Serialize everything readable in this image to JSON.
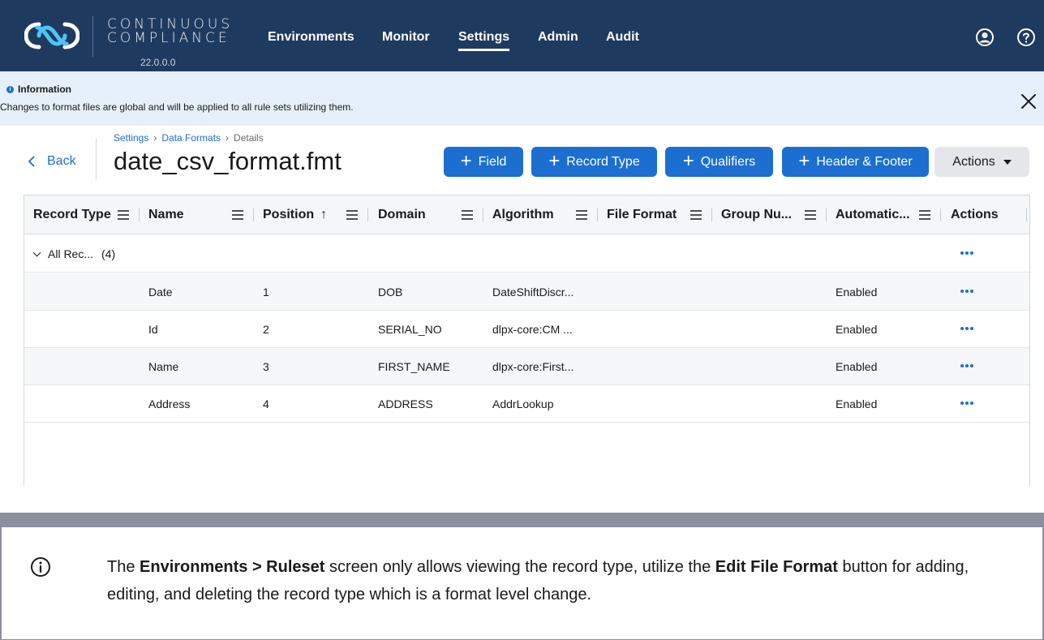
{
  "app": {
    "brand_line1": "CONTINUOUS",
    "brand_line2": "COMPLIANCE",
    "version": "22.0.0.0"
  },
  "nav": {
    "items": [
      {
        "label": "Environments"
      },
      {
        "label": "Monitor"
      },
      {
        "label": "Settings",
        "active": true
      },
      {
        "label": "Admin"
      },
      {
        "label": "Audit"
      }
    ],
    "icons": [
      "user-account-icon",
      "help-icon"
    ]
  },
  "banner": {
    "title": "Information",
    "text": "Changes to format files are global and will be applied to all rule sets utilizing them."
  },
  "page": {
    "back_label": "Back",
    "breadcrumb": [
      "Settings",
      "Data Formats",
      "Details"
    ],
    "title": "date_csv_format.fmt"
  },
  "toolbar": {
    "buttons": [
      "Field",
      "Record Type",
      "Qualifiers",
      "Header & Footer"
    ],
    "actions_label": "Actions"
  },
  "grid": {
    "columns": [
      "Record Type",
      "Name",
      "Position",
      "Domain",
      "Algorithm",
      "File Format",
      "Group Nu...",
      "Automatic...",
      "Actions"
    ],
    "sort_indicator": "↑",
    "group": {
      "label": "All Rec...",
      "count": "(4)"
    },
    "rows": [
      {
        "name": "Date",
        "position": "1",
        "domain": "DOB",
        "algorithm": "DateShiftDiscr...",
        "file_format": "",
        "group": "",
        "automatic": "Enabled"
      },
      {
        "name": "Id",
        "position": "2",
        "domain": "SERIAL_NO",
        "algorithm": "dlpx-core:CM ...",
        "file_format": "",
        "group": "",
        "automatic": "Enabled"
      },
      {
        "name": "Name",
        "position": "3",
        "domain": "FIRST_NAME",
        "algorithm": "dlpx-core:First...",
        "file_format": "",
        "group": "",
        "automatic": "Enabled"
      },
      {
        "name": "Address",
        "position": "4",
        "domain": "ADDRESS",
        "algorithm": "AddrLookup",
        "file_format": "",
        "group": "",
        "automatic": "Enabled"
      }
    ]
  },
  "note": {
    "part1": "The ",
    "bold1": "Environments > Ruleset",
    "part2": " screen only allows viewing the record type, utilize the ",
    "bold2": "Edit File Format",
    "part3": " button for adding, editing, and deleting the record type which is a format level change."
  },
  "colors": {
    "nav_bg": "#1f3a5f",
    "accent": "#1c6fd1",
    "banner_bg": "#e5f0fb",
    "note_border": "#8c8f9e"
  }
}
